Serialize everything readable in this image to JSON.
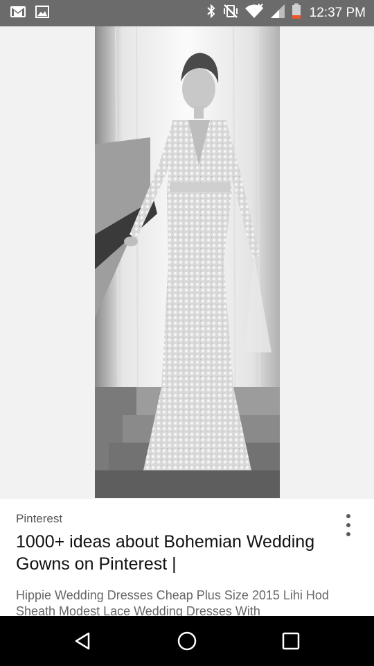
{
  "status_bar": {
    "time": "12:37 PM",
    "left_icons": [
      "gmail-icon",
      "image-icon"
    ],
    "right_icons": [
      "bluetooth-icon",
      "vibrate-off-icon",
      "wifi-icon",
      "signal-icon",
      "battery-icon"
    ]
  },
  "result": {
    "image_alt": "Black and white photo of a bride in a long-sleeve lace wedding gown standing on stairs",
    "source": "Pinterest",
    "title": "1000+ ideas about Bohemian Wedding Gowns on Pinterest |",
    "description": "Hippie Wedding Dresses Cheap Plus Size 2015 Lihi Hod Sheath Modest Lace Wedding Dresses With"
  },
  "nav_bar": {
    "buttons": [
      "back-icon",
      "home-icon",
      "recents-icon"
    ]
  },
  "colors": {
    "status_bar_bg": "#6b6b6b",
    "nav_bar_bg": "#000000",
    "viewer_bg": "#f2f2f2",
    "battery_low": "#e8562a"
  }
}
